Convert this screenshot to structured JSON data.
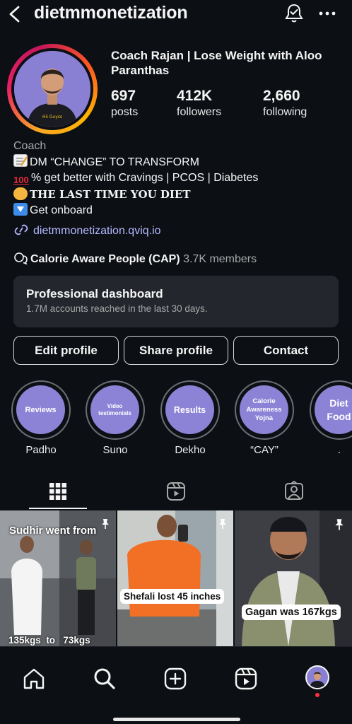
{
  "header": {
    "username": "dietmmonetization"
  },
  "profile": {
    "display_name": "Coach Rajan | Lose Weight with Aloo Paranthas",
    "shirt_text": "Hii Guyss",
    "stats": [
      {
        "value": "697",
        "label": "posts"
      },
      {
        "value": "412K",
        "label": "followers"
      },
      {
        "value": "2,660",
        "label": "following"
      }
    ],
    "category": "Coach",
    "bio": [
      {
        "emoji": "memo-icon",
        "text": "DM “CHANGE” TO TRANSFORM"
      },
      {
        "emoji": "hundred-icon",
        "text": "% get better with Cravings | PCOS | Diabetes"
      },
      {
        "emoji": "handshake-icon",
        "text": "THE LAST TIME YOU DIET"
      },
      {
        "emoji": "down-arrow-icon",
        "text": "Get onboard"
      }
    ],
    "link": "dietmmonetization.qviq.io"
  },
  "community": {
    "name": "Calorie Aware People (CAP)",
    "members": "3.7K members"
  },
  "dashboard": {
    "title": "Professional dashboard",
    "subtitle": "1.7M accounts reached in the last 30 days."
  },
  "buttons": {
    "edit": "Edit profile",
    "share": "Share profile",
    "contact": "Contact"
  },
  "highlights": [
    {
      "cover": "Reviews",
      "label": "Padho"
    },
    {
      "cover": "Video testimonials",
      "label": "Suno"
    },
    {
      "cover": "Results",
      "label": "Dekho"
    },
    {
      "cover": "Calorie Awareness Yojna",
      "label": "“CAY”"
    },
    {
      "cover": "Diet Food",
      "label": "."
    }
  ],
  "posts": [
    {
      "caption_top": "Sudhir went from",
      "caption_left": "135kgs",
      "caption_mid": "to",
      "caption_right": "73kgs"
    },
    {
      "caption": "Shefali lost 45 inches"
    },
    {
      "caption": "Gagan was 167kgs"
    }
  ],
  "colors": {
    "background": "#0c0f14",
    "highlight_cover": "#8d83d6",
    "link": "#b5b8ff",
    "notification_dot": "#ff3040"
  }
}
